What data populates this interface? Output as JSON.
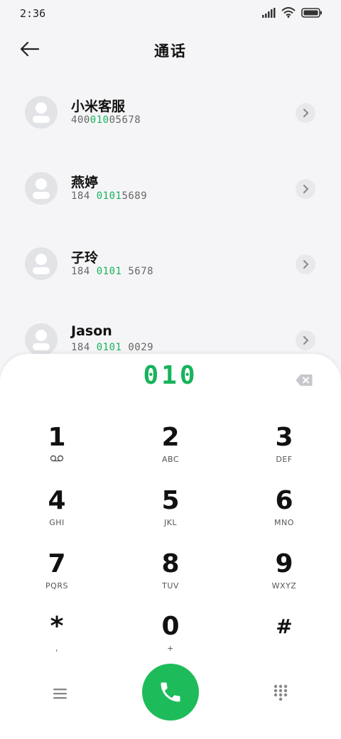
{
  "status": {
    "time": "2:36"
  },
  "header": {
    "title": "通话"
  },
  "contacts": [
    {
      "name": "小米客服",
      "num_pre": "400",
      "num_hl": "010",
      "num_post": "05678"
    },
    {
      "name": "燕婷",
      "num_pre": "184 ",
      "num_hl": "0101",
      "num_post": "5689"
    },
    {
      "name": "子玲",
      "num_pre": "184 ",
      "num_hl": "0101",
      "num_post": " 5678"
    },
    {
      "name": "Jason",
      "num_pre": "184 ",
      "num_hl": "0101",
      "num_post": " 0029"
    }
  ],
  "dialpad": {
    "display": "010",
    "keys": [
      {
        "digit": "1",
        "letters": ""
      },
      {
        "digit": "2",
        "letters": "ABC"
      },
      {
        "digit": "3",
        "letters": "DEF"
      },
      {
        "digit": "4",
        "letters": "GHI"
      },
      {
        "digit": "5",
        "letters": "JKL"
      },
      {
        "digit": "6",
        "letters": "MNO"
      },
      {
        "digit": "7",
        "letters": "PQRS"
      },
      {
        "digit": "8",
        "letters": "TUV"
      },
      {
        "digit": "9",
        "letters": "WXYZ"
      },
      {
        "digit": "*",
        "letters": ","
      },
      {
        "digit": "0",
        "letters": "+"
      },
      {
        "digit": "#",
        "letters": ""
      }
    ]
  },
  "colors": {
    "accent": "#18b35c",
    "call_button": "#1ebb5b"
  },
  "icons": [
    "back-arrow-icon",
    "signal-icon",
    "wifi-icon",
    "battery-icon",
    "chevron-right-icon",
    "backspace-icon",
    "voicemail-icon",
    "menu-icon",
    "phone-icon",
    "keypad-icon"
  ]
}
